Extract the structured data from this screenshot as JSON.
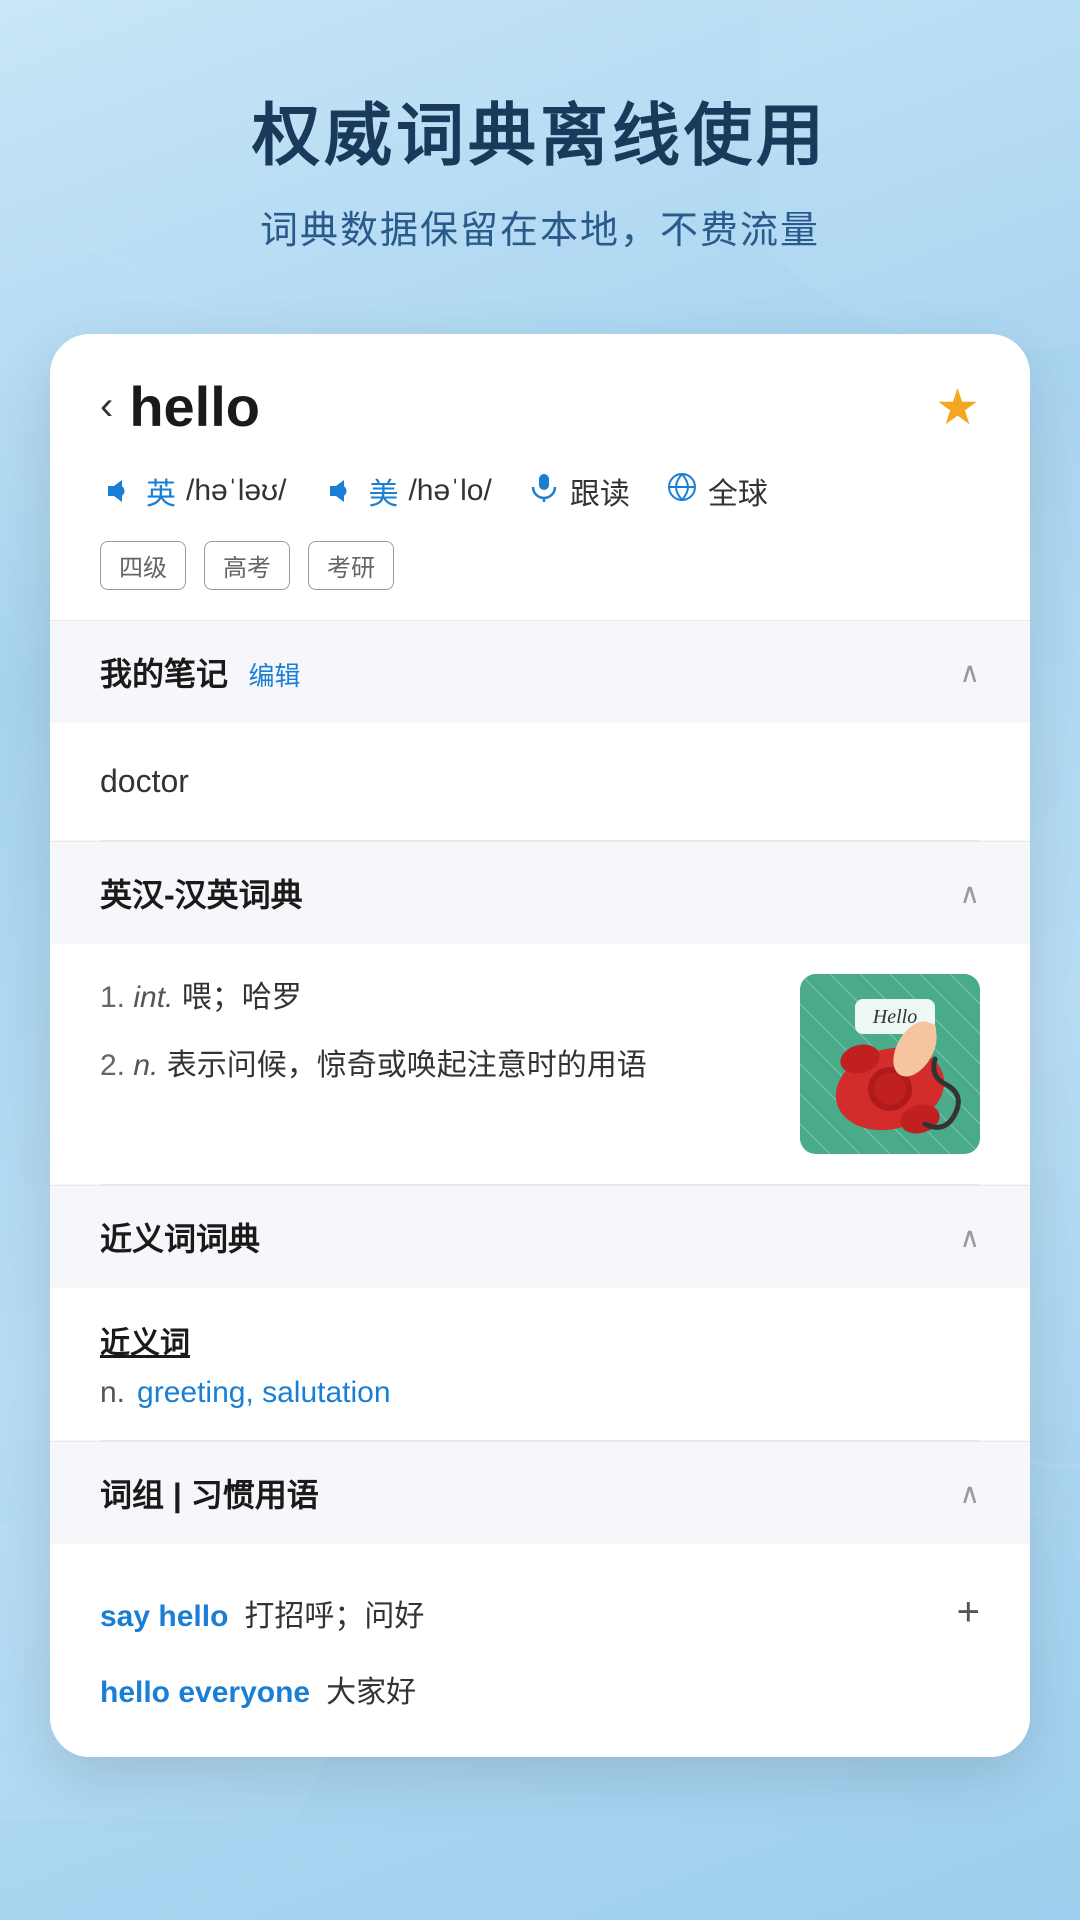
{
  "header": {
    "main_title": "权威词典离线使用",
    "sub_title": "词典数据保留在本地，不费流量"
  },
  "word": {
    "back_label": "‹",
    "text": "hello",
    "star_filled": true,
    "pronunciations": [
      {
        "lang": "英",
        "phonetic": "/həˈləʊ/"
      },
      {
        "lang": "美",
        "phonetic": "/həˈlo/"
      }
    ],
    "actions": [
      {
        "label": "跟读"
      },
      {
        "label": "全球"
      }
    ],
    "tags": [
      "四级",
      "高考",
      "考研"
    ]
  },
  "sections": {
    "notes": {
      "title": "我的笔记",
      "edit_label": "编辑",
      "content": "doctor"
    },
    "dictionary": {
      "title": "英汉-汉英词典",
      "definitions": [
        {
          "num": "1.",
          "pos": "int.",
          "text": "喂；哈罗"
        },
        {
          "num": "2.",
          "pos": "n.",
          "text": "表示问候，惊奇或唤起注意时的用语"
        }
      ]
    },
    "synonyms": {
      "title": "近义词词典",
      "label": "近义词",
      "items": [
        {
          "pos": "n.",
          "words": "greeting, salutation"
        }
      ]
    },
    "phrases": {
      "title": "词组 | 习惯用语",
      "items": [
        {
          "en": "say hello",
          "cn": "打招呼；问好"
        },
        {
          "en": "hello everyone",
          "cn": "大家好"
        }
      ]
    }
  }
}
